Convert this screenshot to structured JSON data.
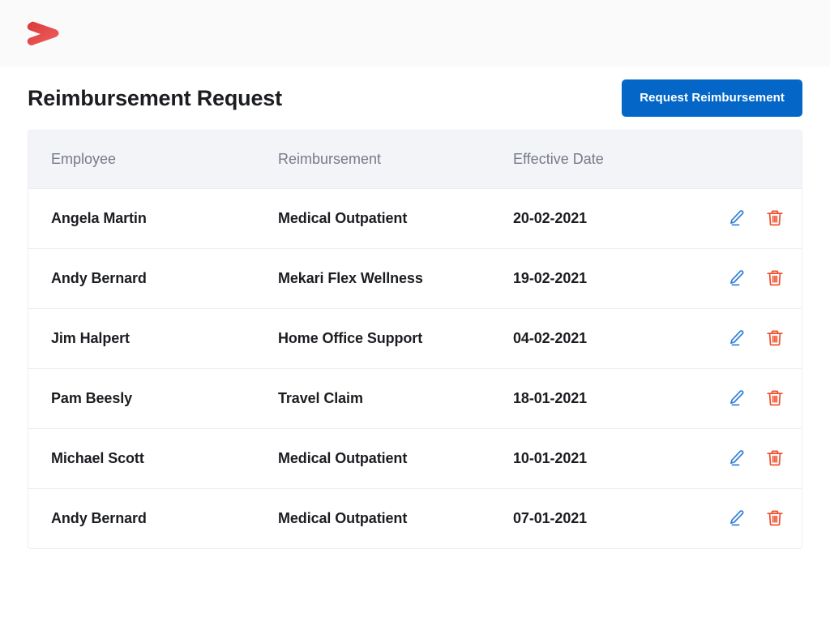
{
  "topbar": {
    "logo_name": "mekari-chevron-logo",
    "logo_color": "#ea4b4b"
  },
  "header": {
    "title": "Reimbursement Request",
    "action_button": {
      "label": "Request Reimbursement",
      "color": "#0467c8",
      "text_color": "#ffffff"
    }
  },
  "table": {
    "columns": [
      "Employee",
      "Reimbursement",
      "Effective Date",
      ""
    ],
    "header_bg": "#f3f4f8",
    "header_text_color": "#757b86",
    "row_actions": {
      "edit_label": "Edit",
      "edit_color": "#2f7fd8",
      "delete_label": "Delete",
      "delete_color": "#ef4e2a"
    },
    "rows": [
      {
        "employee": "Angela Martin",
        "reimbursement": "Medical Outpatient",
        "effective_date": "20-02-2021"
      },
      {
        "employee": "Andy Bernard",
        "reimbursement": "Mekari Flex Wellness",
        "effective_date": "19-02-2021"
      },
      {
        "employee": "Jim Halpert",
        "reimbursement": "Home Office Support",
        "effective_date": "04-02-2021"
      },
      {
        "employee": "Pam Beesly",
        "reimbursement": "Travel Claim",
        "effective_date": "18-01-2021"
      },
      {
        "employee": "Michael Scott",
        "reimbursement": "Medical Outpatient",
        "effective_date": "10-01-2021"
      },
      {
        "employee": "Andy Bernard",
        "reimbursement": "Medical Outpatient",
        "effective_date": "07-01-2021"
      }
    ]
  }
}
